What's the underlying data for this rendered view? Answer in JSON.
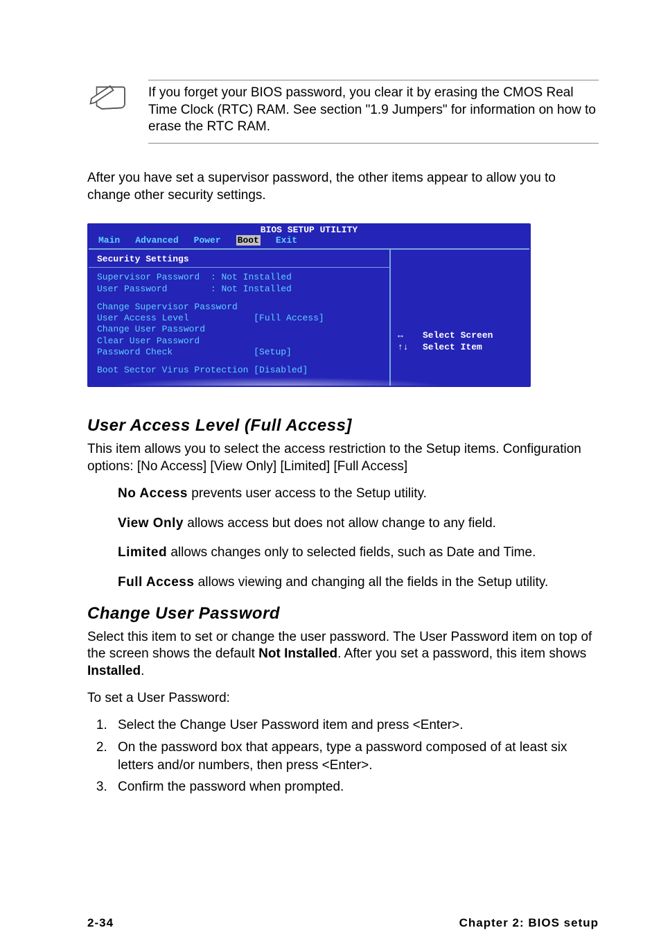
{
  "note": {
    "text": "If you forget your BIOS password, you clear it by erasing the CMOS Real Time Clock (RTC) RAM. See section \"1.9 Jumpers\" for information on how to erase the RTC RAM."
  },
  "intro": "After you have set a supervisor password, the other items appear to allow you to change other security settings.",
  "bios": {
    "title": "BIOS SETUP UTILITY",
    "tabs": [
      "Main",
      "Advanced",
      "Power",
      "Boot",
      "Exit"
    ],
    "active_tab": "Boot",
    "section": "Security Settings",
    "rows": {
      "supervisor_password_label": "Supervisor Password",
      "supervisor_password_value": "Not Installed",
      "user_password_label": "User Password",
      "user_password_value": "Not Installed",
      "change_supervisor": "Change Supervisor Password",
      "user_access_label": "User Access Level",
      "user_access_value": "[Full Access]",
      "change_user": "Change User Password",
      "clear_user": "Clear User Password",
      "password_check_label": "Password Check",
      "password_check_value": "[Setup]",
      "boot_virus_label": "Boot Sector Virus Protection",
      "boot_virus_value": "[Disabled]"
    },
    "help": {
      "lr_sym": "↔",
      "lr_text": "Select Screen",
      "ud_sym": "↑↓",
      "ud_text": "Select Item"
    }
  },
  "ual": {
    "heading": "User Access Level (Full Access]",
    "intro": "This item allows you to select the access restriction to the Setup items. Configuration options: [No Access] [View Only] [Limited] [Full Access]",
    "opts": {
      "no_access_b": "No Access",
      "no_access_t": " prevents user access to the Setup utility.",
      "view_only_b": "View Only",
      "view_only_t": " allows access but does not allow change to any field.",
      "limited_b": "Limited",
      "limited_t": " allows changes only to selected fields, such as Date and Time.",
      "full_access_b": "Full Access",
      "full_access_t": " allows viewing and changing all the fields in the Setup utility."
    }
  },
  "cup": {
    "heading": "Change User Password",
    "p1a": "Select this item to set or change the user password. The User Password item on top of the screen shows the default ",
    "p1b": "Not Installed",
    "p1c": ". After you set a password, this item shows ",
    "p1d": "Installed",
    "p1e": ".",
    "p2": "To set a User Password:",
    "steps": [
      "Select the Change User Password item and press <Enter>.",
      "On the password box that appears, type a password composed of at least six letters and/or numbers, then press <Enter>.",
      "Confirm the password when prompted."
    ]
  },
  "footer": {
    "page": "2-34",
    "chapter": "Chapter 2: BIOS setup"
  }
}
